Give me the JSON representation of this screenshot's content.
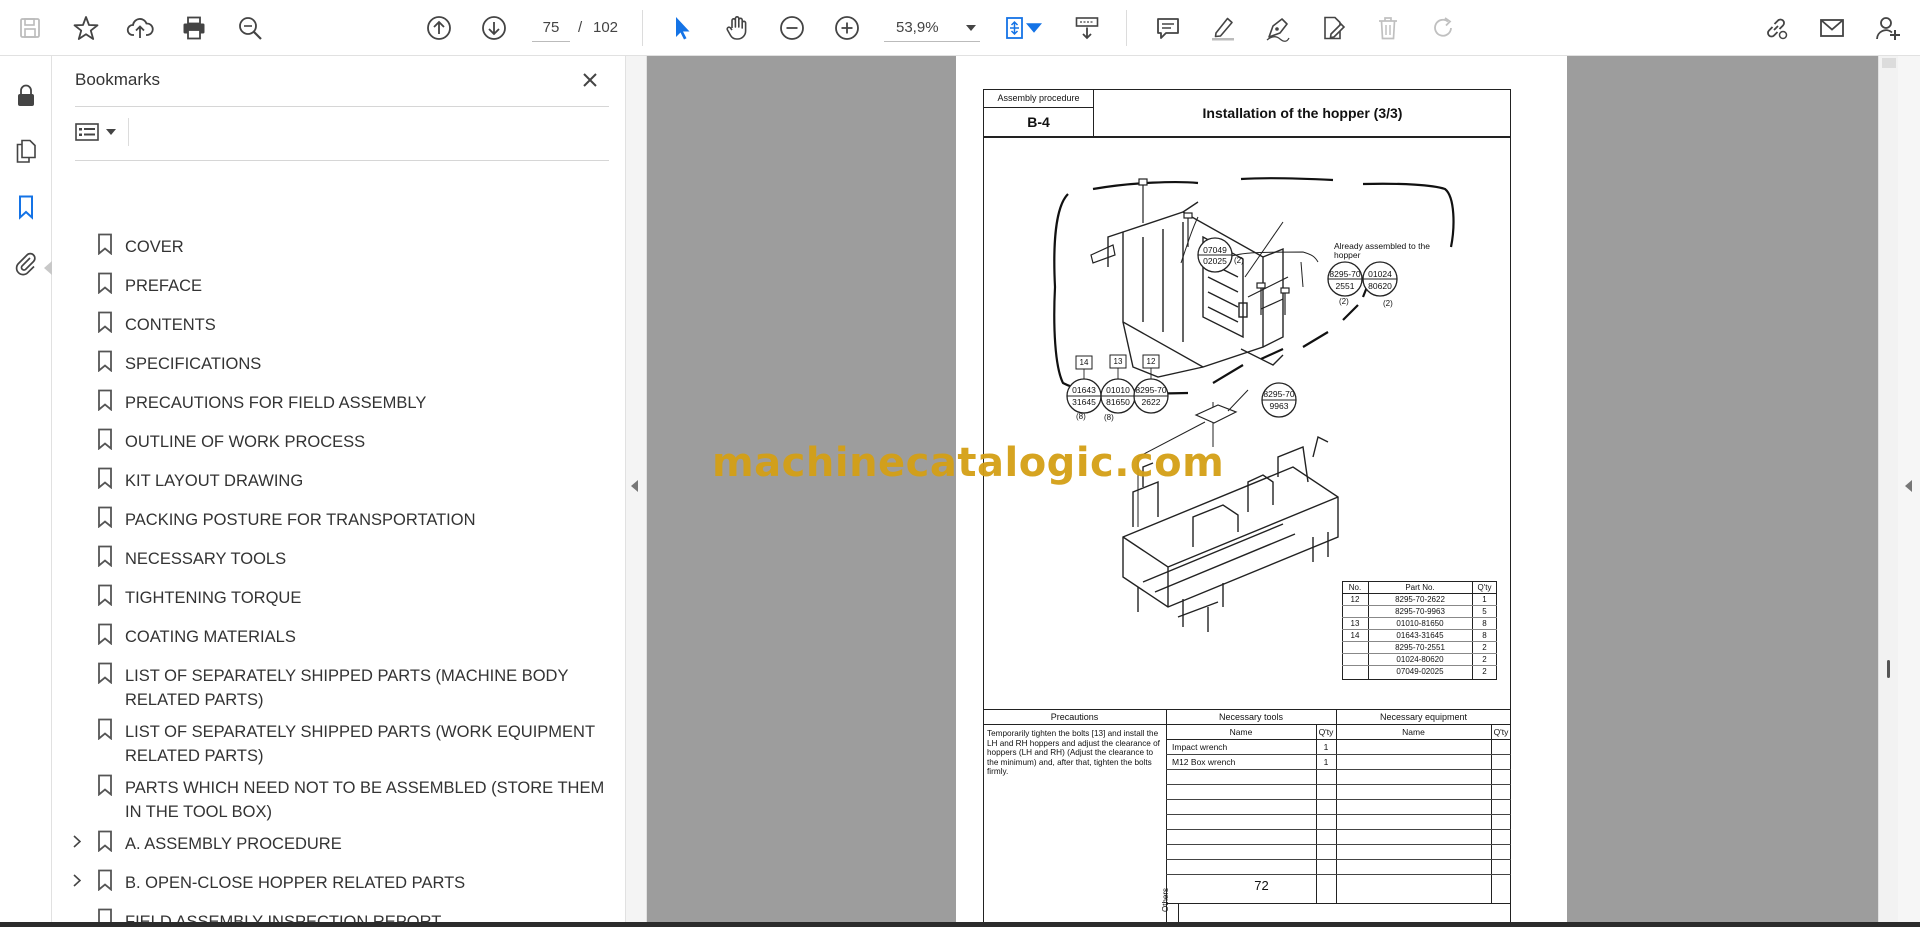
{
  "toolbar": {
    "current_page": "75",
    "page_separator": "/",
    "total_pages": "102",
    "zoom": "53,9%"
  },
  "bookmarks": {
    "title": "Bookmarks",
    "items": [
      {
        "label": "COVER",
        "expandable": false
      },
      {
        "label": "PREFACE",
        "expandable": false
      },
      {
        "label": "CONTENTS",
        "expandable": false
      },
      {
        "label": "SPECIFICATIONS",
        "expandable": false
      },
      {
        "label": "PRECAUTIONS FOR FIELD ASSEMBLY",
        "expandable": false
      },
      {
        "label": "OUTLINE OF WORK PROCESS",
        "expandable": false
      },
      {
        "label": "KIT LAYOUT DRAWING",
        "expandable": false
      },
      {
        "label": "PACKING POSTURE FOR TRANSPORTATION",
        "expandable": false
      },
      {
        "label": "NECESSARY TOOLS",
        "expandable": false
      },
      {
        "label": "TIGHTENING TORQUE",
        "expandable": false
      },
      {
        "label": "COATING MATERIALS",
        "expandable": false
      },
      {
        "label": "LIST OF SEPARATELY SHIPPED PARTS (MACHINE BODY RELATED PARTS)",
        "expandable": false
      },
      {
        "label": "LIST OF SEPARATELY SHIPPED PARTS (WORK EQUIPMENT RELATED PARTS)",
        "expandable": false
      },
      {
        "label": "PARTS WHICH NEED NOT TO BE ASSEMBLED (STORE THEM IN THE TOOL BOX)",
        "expandable": false
      },
      {
        "label": "A. ASSEMBLY PROCEDURE",
        "expandable": true
      },
      {
        "label": "B. OPEN-CLOSE HOPPER RELATED PARTS",
        "expandable": true
      },
      {
        "label": "FIELD ASSEMBLY INSPECTION REPORT",
        "expandable": false
      }
    ]
  },
  "document": {
    "header_label": "Assembly procedure",
    "section_code": "B-4",
    "page_title": "Installation of the hopper (3/3)",
    "page_number": "72",
    "diagram": {
      "callouts": [
        {
          "top": "07049",
          "bottom": "02025",
          "qty": "(2)"
        },
        {
          "top": "8295-70",
          "bottom": "2551",
          "qty": "(2)"
        },
        {
          "top": "01024",
          "bottom": "80620",
          "qty": "(2)"
        },
        {
          "top": "01643",
          "bottom": "31645",
          "qty": "(8)"
        },
        {
          "top": "01010",
          "bottom": "81650",
          "qty": "(8)"
        },
        {
          "top": "8295-70",
          "bottom": "2622",
          "qty": ""
        },
        {
          "top": "8295-70",
          "bottom": "9963",
          "qty": ""
        }
      ],
      "note": "Already assembled to the hopper",
      "item_tags": [
        "14",
        "13",
        "12"
      ]
    },
    "parts_table": {
      "headers": [
        "No.",
        "Part No.",
        "Q'ty"
      ],
      "rows": [
        [
          "12",
          "8295-70-2622",
          "1"
        ],
        [
          "",
          "8295-70-9963",
          "5"
        ],
        [
          "13",
          "01010-81650",
          "8"
        ],
        [
          "14",
          "01643-31645",
          "8"
        ],
        [
          "",
          "8295-70-2551",
          "2"
        ],
        [
          "",
          "01024-80620",
          "2"
        ],
        [
          "",
          "07049-02025",
          "2"
        ]
      ]
    },
    "precautions": {
      "header": "Precautions",
      "text": "Temporarily tighten the bolts [13] and install the LH and RH hoppers and adjust the clearance of hoppers (LH and RH) (Adjust the clearance to the minimum) and, after that, tighten the bolts firmly."
    },
    "tools": {
      "header": "Necessary tools",
      "col_name": "Name",
      "col_qty": "Q'ty",
      "rows": [
        [
          "Impact wrench",
          "1"
        ],
        [
          "M12 Box wrench",
          "1"
        ]
      ]
    },
    "equipment": {
      "header": "Necessary equipment",
      "col_name": "Name",
      "col_qty": "Q'ty"
    },
    "others_label": "Others"
  },
  "watermark": "machinecatalogic.com"
}
